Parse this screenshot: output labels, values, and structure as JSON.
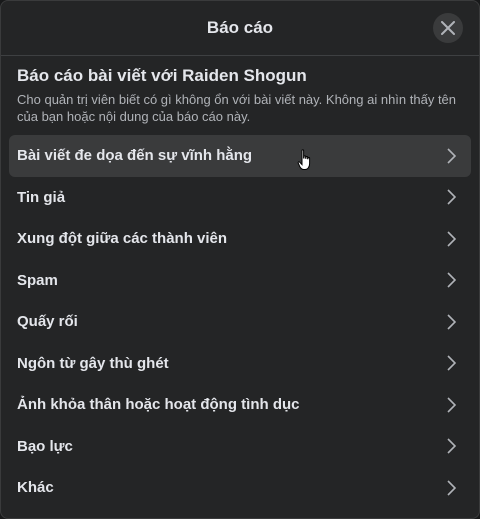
{
  "dialog": {
    "title": "Báo cáo",
    "close_icon": "close-icon"
  },
  "intro": {
    "title": "Báo cáo bài viết với Raiden Shogun",
    "description": "Cho quản trị viên biết có gì không ổn với bài viết này. Không ai nhìn thấy tên của bạn hoặc nội dung của báo cáo này."
  },
  "options": [
    {
      "label": "Bài viết đe dọa đến sự vĩnh hằng"
    },
    {
      "label": "Tin giả"
    },
    {
      "label": "Xung đột giữa các thành viên"
    },
    {
      "label": "Spam"
    },
    {
      "label": "Quấy rối"
    },
    {
      "label": "Ngôn từ gây thù ghét"
    },
    {
      "label": "Ảnh khỏa thân hoặc hoạt động tình dục"
    },
    {
      "label": "Bạo lực"
    },
    {
      "label": "Khác"
    }
  ],
  "colors": {
    "background": "#242526",
    "hover": "#3a3b3c",
    "text_primary": "#e4e6eb",
    "text_secondary": "#b0b3b8"
  }
}
